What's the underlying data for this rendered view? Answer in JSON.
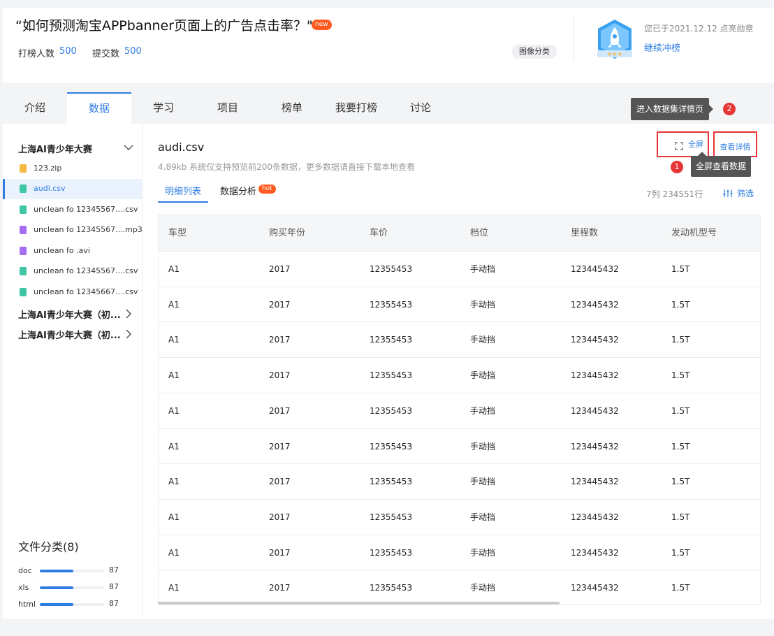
{
  "header": {
    "title": "“如何预测淘宝APPbanner页面上的广告点击率？\"",
    "new_badge": "new",
    "players_label": "打榜人数",
    "players_value": "500",
    "submissions_label": "提交数",
    "submissions_value": "500",
    "tag": "图像分类",
    "medal_text": "您已于2021.12.12 点亮勋章",
    "medal_link": "继续冲榜"
  },
  "tabs": [
    {
      "label": "介绍"
    },
    {
      "label": "数据"
    },
    {
      "label": "学习"
    },
    {
      "label": "项目"
    },
    {
      "label": "榜单"
    },
    {
      "label": "我要打榜"
    },
    {
      "label": "讨论"
    }
  ],
  "tooltips": {
    "dataset_detail": "进入数据集详情页",
    "dataset_detail_num": "2",
    "fullscreen": "全屏查看数据",
    "fullscreen_num": "1"
  },
  "sidebar": {
    "group_open": "上海AI青少年大赛",
    "files": [
      {
        "name": "123.zip",
        "color": "#f5b942"
      },
      {
        "name": "audi.csv",
        "color": "#3ec6a5"
      },
      {
        "name": "unclean fo 12345567....csv",
        "color": "#3ec6a5"
      },
      {
        "name": "unclean fo 12345567....mp3",
        "color": "#a56ef0"
      },
      {
        "name": "unclean fo .avi",
        "color": "#a56ef0"
      },
      {
        "name": "unclean fo 12345567....csv",
        "color": "#3ec6a5"
      },
      {
        "name": "unclean fo 12345667....csv",
        "color": "#3ec6a5"
      }
    ],
    "groups_collapsed": [
      "上海AI青少年大赛（初...",
      "上海AI青少年大赛（初..."
    ],
    "category_title": "文件分类(8)",
    "categories": [
      {
        "label": "doc",
        "value": "87",
        "fill": 0.52
      },
      {
        "label": "xls",
        "value": "87",
        "fill": 0.52
      },
      {
        "label": "html",
        "value": "87",
        "fill": 0.52
      }
    ]
  },
  "main": {
    "file_title": "audi.csv",
    "file_sub": "4.89kb  系统仅支持预览前200条数据，更多数据请直接下载本地查看",
    "subtab_detail": "明细列表",
    "subtab_analysis": "数据分析",
    "hot_badge": "hot",
    "counts": "7列  234551行",
    "filter_label": "筛选",
    "fullscreen_label": "全屏",
    "detail_label": "查看详情"
  },
  "table": {
    "columns": [
      "车型",
      "购买年份",
      "车价",
      "档位",
      "里程数",
      "发动机型号"
    ],
    "rows": [
      [
        "A1",
        "2017",
        "12355453",
        "手动挡",
        "123445432",
        "1.5T"
      ],
      [
        "A1",
        "2017",
        "12355453",
        "手动挡",
        "123445432",
        "1.5T"
      ],
      [
        "A1",
        "2017",
        "12355453",
        "手动挡",
        "123445432",
        "1.5T"
      ],
      [
        "A1",
        "2017",
        "12355453",
        "手动挡",
        "123445432",
        "1.5T"
      ],
      [
        "A1",
        "2017",
        "12355453",
        "手动挡",
        "123445432",
        "1.5T"
      ],
      [
        "A1",
        "2017",
        "12355453",
        "手动挡",
        "123445432",
        "1.5T"
      ],
      [
        "A1",
        "2017",
        "12355453",
        "手动挡",
        "123445432",
        "1.5T"
      ],
      [
        "A1",
        "2017",
        "12355453",
        "手动挡",
        "123445432",
        "1.5T"
      ],
      [
        "A1",
        "2017",
        "12355453",
        "手动挡",
        "123445432",
        "1.5T"
      ],
      [
        "A1",
        "2017",
        "12355453",
        "手动挡",
        "123445432",
        "1.5T"
      ]
    ]
  }
}
